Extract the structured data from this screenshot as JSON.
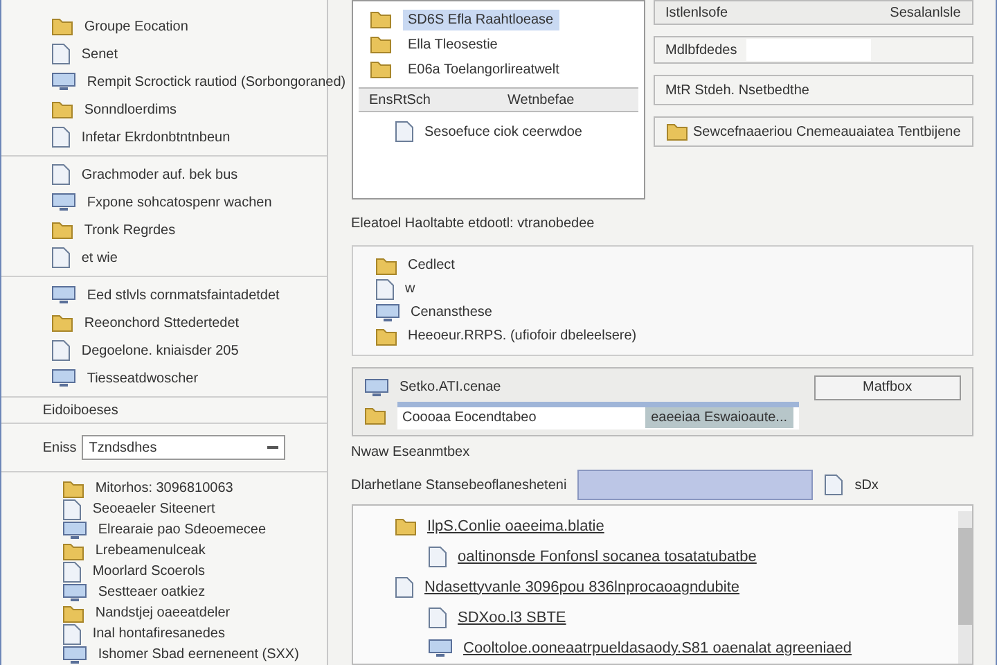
{
  "left_panel": {
    "groups": [
      {
        "items": [
          "Groupe Eocation",
          "Senet",
          "Rempit Scroctick rautiod (Sorbongoraned)",
          "Sonndloerdims",
          "Infetar Ekrdonbtntnbeun"
        ]
      },
      {
        "items": [
          "Grachmoder auf. bek bus",
          "Fxpone sohcatospenr wachen",
          "Tronk Regrdes",
          "et wie"
        ]
      },
      {
        "items": [
          "Eed stlvls cornmatsfaintadetdet",
          "Reeonchord Sttedertedet",
          "Degoelone. kniaisder 205",
          "Tiesseatdwoscher"
        ]
      }
    ],
    "section_label": "Eidoiboeses",
    "field": {
      "label": "Eniss",
      "value": "Tzndsdhes"
    },
    "list": [
      "Mitorhos: 3096810063",
      "Seoeaeler Siteenert",
      "Elrearaie pao Sdeoemecee",
      "Lrebeamenulceak",
      "Moorlard Scoerols",
      "Sestteaer oatkiez",
      "Nandstjej oaeeatdeler",
      "Inal hontafiresanedes",
      "Ishomer Sbad eerneneent (SXX)"
    ]
  },
  "top_tree": {
    "rows": [
      {
        "label": "SD6S Efla Raahtloease",
        "selected": true
      },
      {
        "label": "Ella Tleosestie",
        "selected": false
      },
      {
        "label": "E06a Toelangorlireatwelt",
        "selected": false
      }
    ],
    "columns": [
      "EnsRtSch",
      "Wetnbefae"
    ],
    "entry": "Sesoefuce ciok ceerwdoe"
  },
  "properties": {
    "row_1": {
      "label": "Istlenlsofe",
      "value": "Sesalanlsle"
    },
    "field": {
      "label": "Mdlbfdedes"
    },
    "row_3": "MtR Stdeh. Nsetbedthe",
    "row_4": "Sewcefnaaeriou Cnemeauaiatea Tentbijene"
  },
  "section": {
    "title": "Eleatoel Haoltabte etdootl: vtranobedee",
    "items": [
      "Cedlect",
      "w",
      "Cenansthese",
      "Heeoeur.RRPS. (ufiofoir dbeleelsere)"
    ]
  },
  "picker": {
    "text": "Setko.ATI.cenae",
    "button": "Matfbox",
    "option": "Coooaa Eocendtabeo",
    "option_detail": "eaeeiaa Eswaioaute..."
  },
  "caption": "Nwaw Eseanmtbex",
  "bar_row": {
    "label": "Dlarhetlane Stansebeoflanesheteni",
    "unit": "sDx"
  },
  "tree": [
    {
      "label": "IlpS.Conlie oaeeima.blatie",
      "children": [
        {
          "label": "oaltinonsde Fonfonsl socanea tosatatubatbe"
        }
      ]
    },
    {
      "label": "Ndasettyvanle 3096pou 836lnprocaoagndubite",
      "children": [
        {
          "label": "SDXoo.l3 SBTE"
        },
        {
          "label": "Cooltoloe.ooneaatrpueldasaody.S81 oaenalat agreeniaed"
        }
      ]
    }
  ]
}
